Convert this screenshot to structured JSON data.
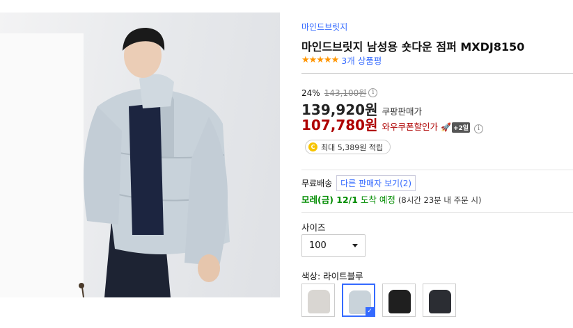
{
  "product": {
    "brand": "마인드브릿지",
    "title": "마인드브릿지 남성용 숏다운 점퍼 MXDJ8150",
    "stars": "★★★★★",
    "review_count": "3개 상품평"
  },
  "price": {
    "discount_rate": "24%",
    "original_price": "143,100원",
    "coupang_price": "139,920원",
    "coupang_label": "쿠팡판매가",
    "wow_price": "107,780원",
    "wow_label": "와우쿠폰할인가",
    "plus_badge": "+2일",
    "info_icon": "i"
  },
  "cash": {
    "coin_icon": "C",
    "text": "최대 5,389원 적립"
  },
  "shipping": {
    "label": "무료배송",
    "other_sellers": "다른 판매자 보기(2)",
    "arrival_date": "모레(금) 12/1",
    "arrival_suffix": "도착 예정",
    "remaining": "(8시간 23분 내 주문 시)"
  },
  "options": {
    "size_label": "사이즈",
    "size_value": "100",
    "color_label": "색상: 라이트블루"
  },
  "swatch_colors": [
    "#d9d6d2",
    "#c9d3da",
    "#1f1f1f",
    "#2b2d33"
  ],
  "accent_color": "#346aff",
  "wow_color": "#ae0000"
}
